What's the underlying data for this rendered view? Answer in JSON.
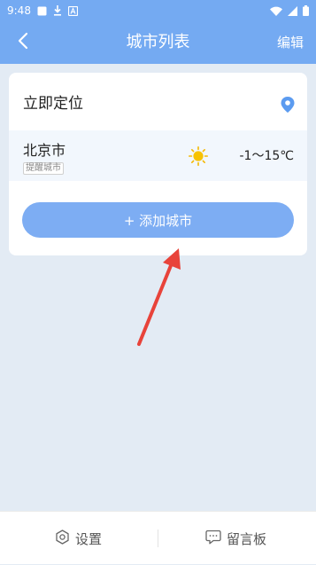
{
  "status_bar": {
    "time": "9:48"
  },
  "header": {
    "title": "城市列表",
    "edit_label": "编辑"
  },
  "locate": {
    "label": "立即定位"
  },
  "cities": [
    {
      "name": "北京市",
      "tag": "提醒城市",
      "temp": "-1～15℃",
      "weather_icon": "sun-icon"
    }
  ],
  "add_city": {
    "label": "+ 添加城市"
  },
  "bottom_tabs": [
    {
      "label": "设置",
      "icon": "gear-icon"
    },
    {
      "label": "留言板",
      "icon": "message-icon"
    }
  ],
  "colors": {
    "primary": "#74aaf2",
    "button": "#7dadf3",
    "background": "#e3ebf4",
    "sun": "#f5b800",
    "annotation_arrow": "#e8433a"
  }
}
